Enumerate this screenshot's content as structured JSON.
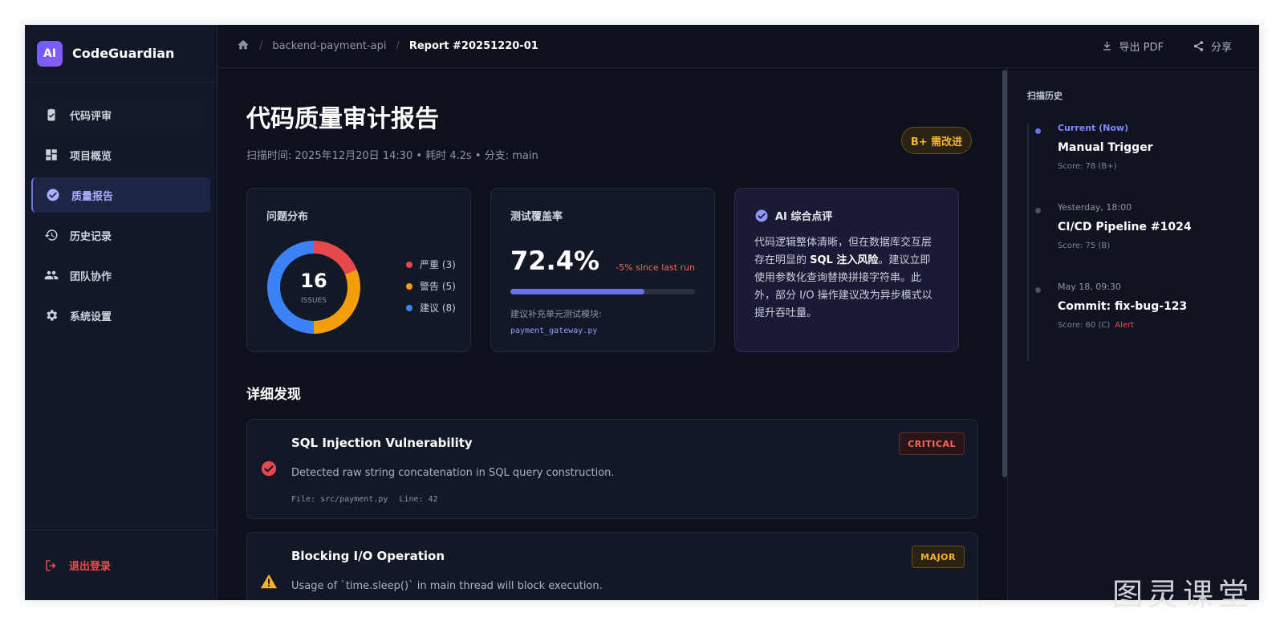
{
  "brand": {
    "logo": "AI",
    "name": "CodeGuardian"
  },
  "sidebar": {
    "items": [
      {
        "label": "代码评审",
        "icon": "clipboard-check-icon"
      },
      {
        "label": "项目概览",
        "icon": "dashboard-icon"
      },
      {
        "label": "质量报告",
        "icon": "check-circle-icon",
        "active": true
      },
      {
        "label": "历史记录",
        "icon": "history-icon"
      },
      {
        "label": "团队协作",
        "icon": "team-icon"
      },
      {
        "label": "系统设置",
        "icon": "gear-icon"
      }
    ],
    "logout": "退出登录"
  },
  "topbar": {
    "breadcrumb": {
      "project": "backend-payment-api",
      "report": "Report #20251220-01"
    },
    "export_label": "导出 PDF",
    "share_label": "分享"
  },
  "report": {
    "title": "代码质量审计报告",
    "meta": "扫描时间: 2025年12月20日 14:30 • 耗时 4.2s • 分支: main",
    "grade": "B+ 需改进"
  },
  "issues_card": {
    "title": "问题分布",
    "total": "16",
    "unit": "ISSUES",
    "legend": [
      {
        "label": "严重 (3)",
        "count": 3,
        "color": "#e5484d"
      },
      {
        "label": "警告 (5)",
        "count": 5,
        "color": "#f59e0b"
      },
      {
        "label": "建议 (8)",
        "count": 8,
        "color": "#3b82f6"
      }
    ]
  },
  "coverage_card": {
    "title": "测试覆盖率",
    "value": "72.4%",
    "percent": 72.4,
    "delta": "-5% since last run",
    "note": "建议补充单元测试模块:",
    "file": "payment_gateway.py"
  },
  "ai_card": {
    "title": "AI 综合点评",
    "text_before": "代码逻辑整体清晰，但在数据库交互层存在明显的 ",
    "highlight": "SQL 注入风险",
    "text_after": "。建议立即使用参数化查询替换拼接字符串。此外，部分 I/O 操作建议改为异步模式以提升吞吐量。"
  },
  "findings": {
    "section_title": "详细发现",
    "items": [
      {
        "title": "SQL Injection Vulnerability",
        "severity": "CRITICAL",
        "description": "Detected raw string concatenation in SQL query construction.",
        "file": "File: src/payment.py",
        "line": "Line: 42"
      },
      {
        "title": "Blocking I/O Operation",
        "severity": "MAJOR",
        "description": "Usage of `time.sleep()` in main thread will block execution."
      }
    ]
  },
  "history": {
    "title": "扫描历史",
    "items": [
      {
        "when": "Current (Now)",
        "name": "Manual Trigger",
        "score": "Score: 78 (B+)",
        "alert": ""
      },
      {
        "when": "Yesterday, 18:00",
        "name": "CI/CD Pipeline #1024",
        "score": "Score: 75 (B)",
        "alert": ""
      },
      {
        "when": "May 18, 09:30",
        "name": "Commit: fix-bug-123",
        "score": "Score: 60 (C)",
        "alert": "Alert"
      }
    ]
  },
  "watermark": "图灵课堂"
}
